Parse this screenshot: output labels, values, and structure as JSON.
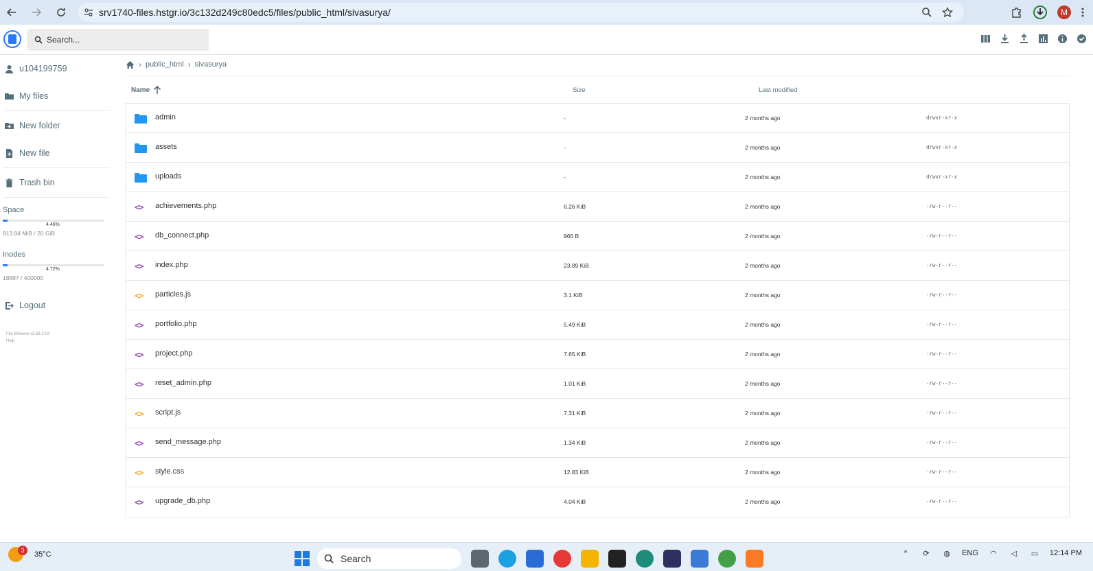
{
  "browser": {
    "url": "srv1740-files.hstgr.io/3c132d249c80edc5/files/public_html/sivasurya/",
    "profile_initial": "M"
  },
  "app": {
    "search_placeholder": "Search...",
    "accent_color": "#2979ff",
    "toolbar_icons": [
      "view-mode-icon",
      "download-icon",
      "upload-icon",
      "stats-icon",
      "info-icon",
      "select-icon"
    ]
  },
  "sidebar": {
    "user": "u104199759",
    "items": [
      {
        "label": "My files",
        "icon": "folder-icon"
      },
      {
        "label": "New folder",
        "icon": "new-folder-icon"
      },
      {
        "label": "New file",
        "icon": "new-file-icon"
      },
      {
        "label": "Trash bin",
        "icon": "trash-icon"
      }
    ],
    "space": {
      "label": "Space",
      "percent_text": "4.46%",
      "fraction": 0.0446,
      "detail": "913.94 MiB / 20 GiB"
    },
    "inodes": {
      "label": "Inodes",
      "percent_text": "4.72%",
      "fraction": 0.0472,
      "detail": "18897 / 400000"
    },
    "logout": "Logout",
    "credits_line1": "File Browser v2.63.2-h2",
    "credits_line2": "Help"
  },
  "breadcrumb": {
    "home_icon": "home-icon",
    "parts": [
      "public_html",
      "sivasurya"
    ]
  },
  "list": {
    "columns": {
      "name": "Name",
      "size": "Size",
      "modified": "Last modified"
    },
    "colors": {
      "folder": "#2196f3",
      "php": "#8e44ad",
      "js_css": "#f5a623"
    },
    "rows": [
      {
        "name": "admin",
        "type": "folder",
        "size": "-",
        "modified": "2 months ago",
        "perm": "drwxr-xr-x"
      },
      {
        "name": "assets",
        "type": "folder",
        "size": "-",
        "modified": "2 months ago",
        "perm": "drwxr-xr-x"
      },
      {
        "name": "uploads",
        "type": "folder",
        "size": "-",
        "modified": "2 months ago",
        "perm": "drwxr-xr-x"
      },
      {
        "name": "achievements.php",
        "type": "php",
        "size": "6.26 KiB",
        "modified": "2 months ago",
        "perm": "-rw-r--r--"
      },
      {
        "name": "db_connect.php",
        "type": "php",
        "size": "965 B",
        "modified": "2 months ago",
        "perm": "-rw-r--r--"
      },
      {
        "name": "index.php",
        "type": "php",
        "size": "23.89 KiB",
        "modified": "2 months ago",
        "perm": "-rw-r--r--"
      },
      {
        "name": "particles.js",
        "type": "js",
        "size": "3.1 KiB",
        "modified": "2 months ago",
        "perm": "-rw-r--r--"
      },
      {
        "name": "portfolio.php",
        "type": "php",
        "size": "5.49 KiB",
        "modified": "2 months ago",
        "perm": "-rw-r--r--"
      },
      {
        "name": "project.php",
        "type": "php",
        "size": "7.65 KiB",
        "modified": "2 months ago",
        "perm": "-rw-r--r--"
      },
      {
        "name": "reset_admin.php",
        "type": "php",
        "size": "1.01 KiB",
        "modified": "2 months ago",
        "perm": "-rw-r--r--"
      },
      {
        "name": "script.js",
        "type": "js",
        "size": "7.31 KiB",
        "modified": "2 months ago",
        "perm": "-rw-r--r--"
      },
      {
        "name": "send_message.php",
        "type": "php",
        "size": "1.34 KiB",
        "modified": "2 months ago",
        "perm": "-rw-r--r--"
      },
      {
        "name": "style.css",
        "type": "css",
        "size": "12.83 KiB",
        "modified": "2 months ago",
        "perm": "-rw-r--r--"
      },
      {
        "name": "upgrade_db.php",
        "type": "php",
        "size": "4.04 KiB",
        "modified": "2 months ago",
        "perm": "-rw-r--r--"
      }
    ]
  },
  "taskbar": {
    "weather_badge": "3",
    "temperature": "35°C",
    "search_label": "Search",
    "language": "ENG",
    "time": "12:14 PM"
  }
}
